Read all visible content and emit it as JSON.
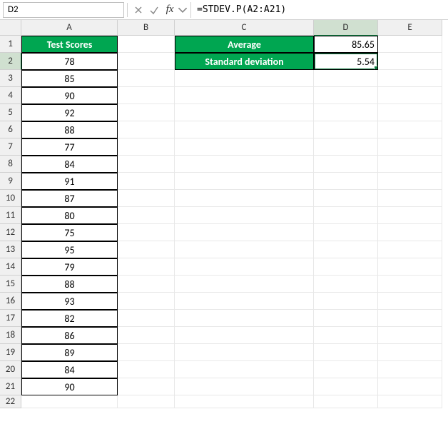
{
  "formula_bar": {
    "name_box": "D2",
    "formula": "=STDEV.P(A2:A21)"
  },
  "columns": [
    "A",
    "B",
    "C",
    "D",
    "E"
  ],
  "headers": {
    "test_scores": "Test Scores",
    "average": "Average",
    "stddev": "Standard deviation"
  },
  "scores": [
    "78",
    "85",
    "90",
    "92",
    "88",
    "77",
    "84",
    "91",
    "87",
    "80",
    "75",
    "95",
    "79",
    "88",
    "93",
    "82",
    "86",
    "89",
    "84",
    "90"
  ],
  "results": {
    "average": "85.65",
    "stddev": "5.54"
  },
  "selected_cell": "D2",
  "chart_data": {
    "type": "table",
    "title": "Test Scores",
    "categories": [
      "Row 2",
      "Row 3",
      "Row 4",
      "Row 5",
      "Row 6",
      "Row 7",
      "Row 8",
      "Row 9",
      "Row 10",
      "Row 11",
      "Row 12",
      "Row 13",
      "Row 14",
      "Row 15",
      "Row 16",
      "Row 17",
      "Row 18",
      "Row 19",
      "Row 20",
      "Row 21"
    ],
    "values": [
      78,
      85,
      90,
      92,
      88,
      77,
      84,
      91,
      87,
      80,
      75,
      95,
      79,
      88,
      93,
      82,
      86,
      89,
      84,
      90
    ],
    "summary": {
      "Average": 85.65,
      "Standard deviation": 5.54
    }
  }
}
